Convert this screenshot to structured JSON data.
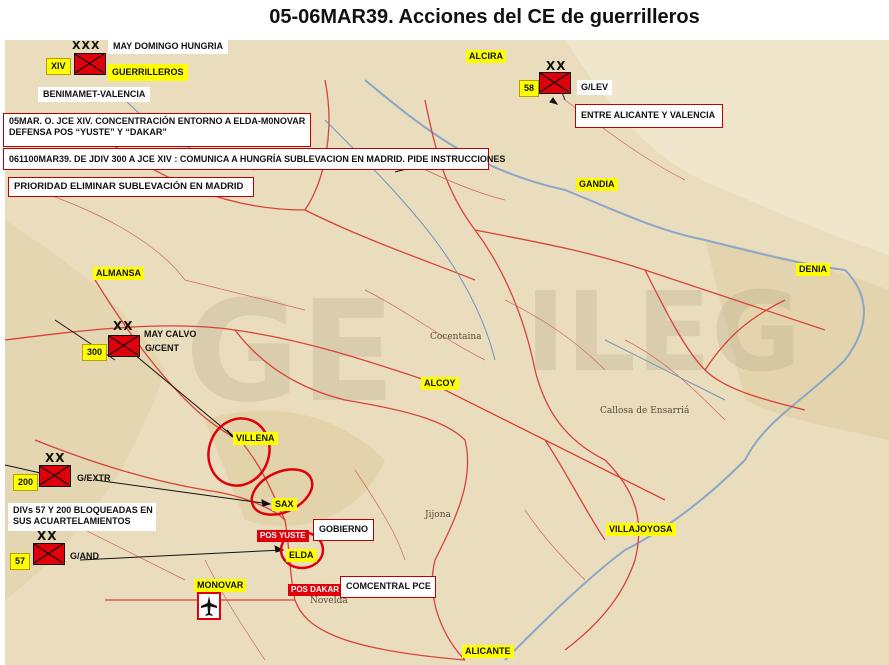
{
  "title": "05-06MAR39. Acciones del CE de guerrilleros",
  "colors": {
    "map_bg": "#e9ddbd",
    "road": "#d8433a",
    "accent_red": "#e0000b",
    "label_yellow": "#ffff00"
  },
  "info_boxes": {
    "jce_note": "05MAR. O. JCE XIV.  CONCENTRACIÓN ENTORNO A ELDA-M0NOVAR DEFENSA POS “YUSTE” Y “DAKAR”",
    "jce_note_line1": "05MAR. O. JCE XIV.  CONCENTRACIÓN ENTORNO A ELDA-M0NOVAR",
    "jce_note_line2": "DEFENSA POS “YUSTE” Y “DAKAR”",
    "jdiv_note": "061100MAR39. DE JDIV 300 A  JCE XIV : COMUNICA A HUNGRÍA SUBLEVACION EN MADRID. PIDE INSTRUCCIONES",
    "priority": "PRIORIDAD  ELIMINAR SUBLEVACIÓN EN MADRID",
    "benimamet": "BENIMAMET-VALENCIA",
    "entre": "ENTRE ALICANTE Y VALENCIA",
    "divs_line1": "DIVs 57  Y 200 BLOQUEADAS EN",
    "divs_line2": "SUS ACUARTELAMIENTOS",
    "gobierno": "GOBIERNO",
    "comcentral": "COMCENTRAL PCE"
  },
  "units": {
    "xiv": {
      "number": "XIV",
      "commander": "MAY DOMINGO HUNGRIA",
      "name": "GUERRILLEROS",
      "echelon": "XXX"
    },
    "u58": {
      "number": "58",
      "name": "G/LEV",
      "echelon": "XX"
    },
    "u300": {
      "number": "300",
      "name": "G/CENT",
      "commander": "MAY CALVO",
      "echelon": "XX"
    },
    "u200": {
      "number": "200",
      "name": "G/EXTR",
      "echelon": "XX"
    },
    "u57": {
      "number": "57",
      "name": "G/AND",
      "echelon": "XX"
    }
  },
  "places": {
    "alcira": "ALCIRA",
    "gandia": "GANDIA",
    "almansa": "ALMANSA",
    "denia": "DENIA",
    "alcoy": "ALCOY",
    "villena": "VILLENA",
    "sax": "SAX",
    "elda": "ELDA",
    "monovar": "MONOVAR",
    "villajoyosa": "VILLAJOYOSA",
    "alicante": "ALICANTE"
  },
  "positions": {
    "yuste": "POS YUSTE",
    "dakar": "POS DAKAR"
  },
  "map_text": {
    "cocentaina": "Cocentaina",
    "callosa": "Callosa de Ensarriá",
    "novelda": "Novelda",
    "jijona": "Jijona",
    "ensarria": "ALICANTE"
  }
}
